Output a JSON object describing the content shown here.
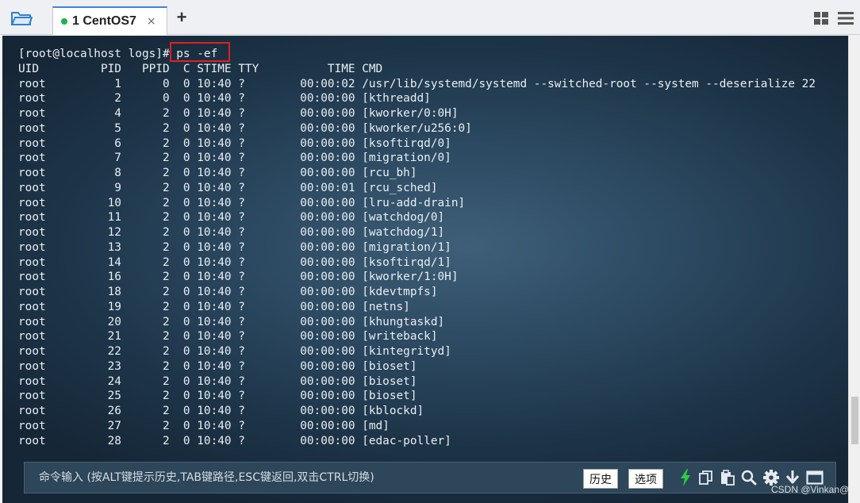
{
  "tab": {
    "label": "1 CentOS7",
    "close": "×",
    "status_color": "#22b14c"
  },
  "toolbar": {
    "add_tab": "+"
  },
  "terminal": {
    "lines": [
      "[root@localhost logs]# ps -ef",
      "UID         PID   PPID  C STIME TTY          TIME CMD",
      "root          1      0  0 10:40 ?        00:00:02 /usr/lib/systemd/systemd --switched-root --system --deserialize 22",
      "root          2      0  0 10:40 ?        00:00:00 [kthreadd]",
      "root          4      2  0 10:40 ?        00:00:00 [kworker/0:0H]",
      "root          5      2  0 10:40 ?        00:00:00 [kworker/u256:0]",
      "root          6      2  0 10:40 ?        00:00:00 [ksoftirqd/0]",
      "root          7      2  0 10:40 ?        00:00:00 [migration/0]",
      "root          8      2  0 10:40 ?        00:00:00 [rcu_bh]",
      "root          9      2  0 10:40 ?        00:00:01 [rcu_sched]",
      "root         10      2  0 10:40 ?        00:00:00 [lru-add-drain]",
      "root         11      2  0 10:40 ?        00:00:00 [watchdog/0]",
      "root         12      2  0 10:40 ?        00:00:00 [watchdog/1]",
      "root         13      2  0 10:40 ?        00:00:00 [migration/1]",
      "root         14      2  0 10:40 ?        00:00:00 [ksoftirqd/1]",
      "root         16      2  0 10:40 ?        00:00:00 [kworker/1:0H]",
      "root         18      2  0 10:40 ?        00:00:00 [kdevtmpfs]",
      "root         19      2  0 10:40 ?        00:00:00 [netns]",
      "root         20      2  0 10:40 ?        00:00:00 [khungtaskd]",
      "root         21      2  0 10:40 ?        00:00:00 [writeback]",
      "root         22      2  0 10:40 ?        00:00:00 [kintegrityd]",
      "root         23      2  0 10:40 ?        00:00:00 [bioset]",
      "root         24      2  0 10:40 ?        00:00:00 [bioset]",
      "root         25      2  0 10:40 ?        00:00:00 [bioset]",
      "root         26      2  0 10:40 ?        00:00:00 [kblockd]",
      "root         27      2  0 10:40 ?        00:00:00 [md]",
      "root         28      2  0 10:40 ?        00:00:00 [edac-poller]"
    ],
    "highlight_color": "#e02020"
  },
  "command_bar": {
    "placeholder": "命令输入 (按ALT键提示历史,TAB键路径,ESC键返回,双击CTRL切换)",
    "history_label": "历史",
    "options_label": "选项"
  },
  "icons": [
    "folder-icon",
    "grid-icon",
    "menu-icon",
    "lightning-icon",
    "copy-icon",
    "paste-icon",
    "search-icon",
    "gear-icon",
    "download-icon",
    "window-icon"
  ],
  "watermark": "CSDN @Vinkan@"
}
